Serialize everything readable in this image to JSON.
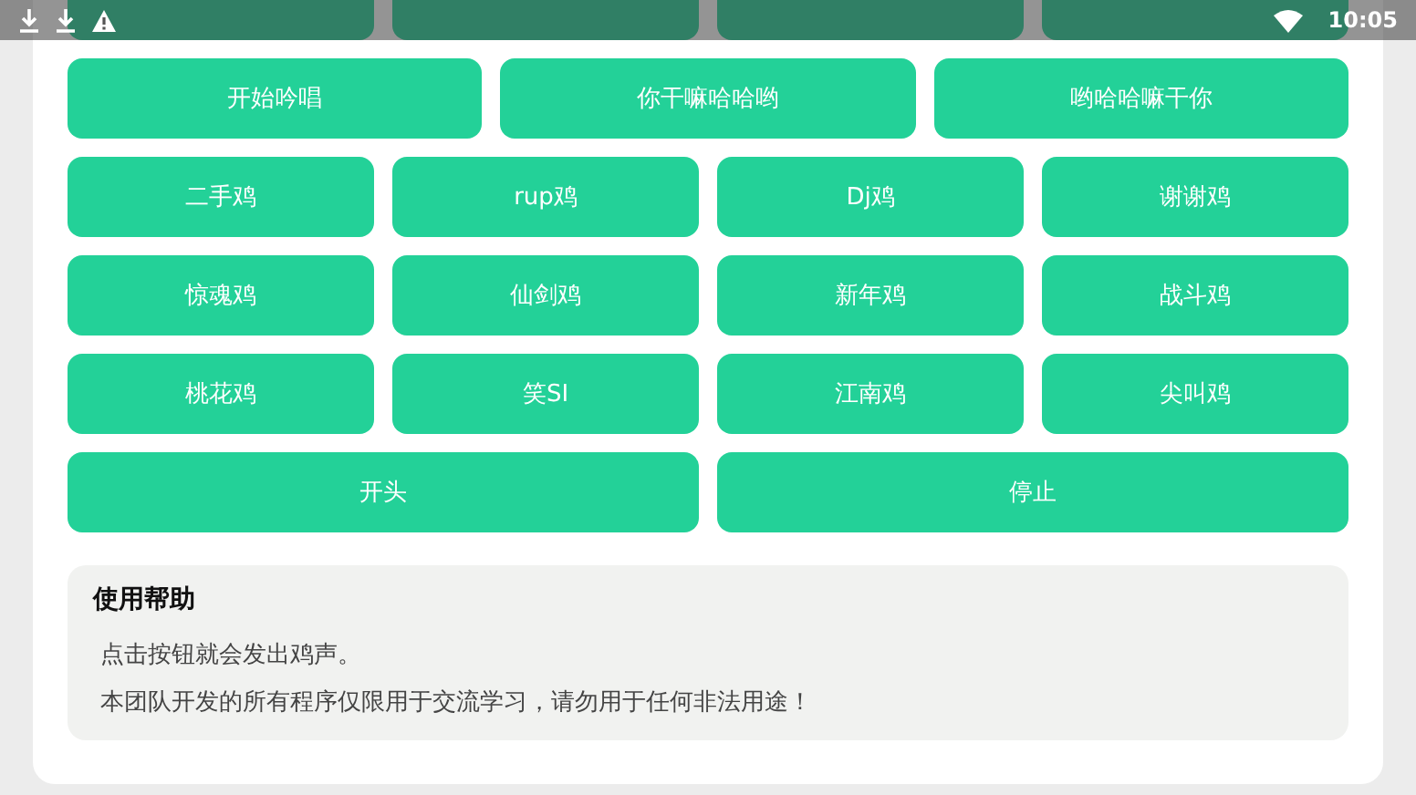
{
  "status_bar": {
    "time": "10:05"
  },
  "top_row": [
    {
      "kind": "button"
    },
    {
      "kind": "button"
    },
    {
      "kind": "button"
    },
    {
      "kind": "button"
    }
  ],
  "rows": [
    {
      "buttons": [
        "开始吟唱",
        "你干嘛哈哈哟",
        "哟哈哈嘛干你"
      ]
    },
    {
      "buttons": [
        "二手鸡",
        "rup鸡",
        "Dj鸡",
        "谢谢鸡"
      ]
    },
    {
      "buttons": [
        "惊魂鸡",
        "仙剑鸡",
        "新年鸡",
        "战斗鸡"
      ]
    },
    {
      "buttons": [
        "桃花鸡",
        "笑SI",
        "江南鸡",
        "尖叫鸡"
      ]
    },
    {
      "buttons": [
        "开头",
        "停止"
      ]
    }
  ],
  "help": {
    "title": "使用帮助",
    "lines": [
      "点击按钮就会发出鸡声。",
      "本团队开发的所有程序仅限用于交流学习，请勿用于任何非法用途！"
    ]
  }
}
